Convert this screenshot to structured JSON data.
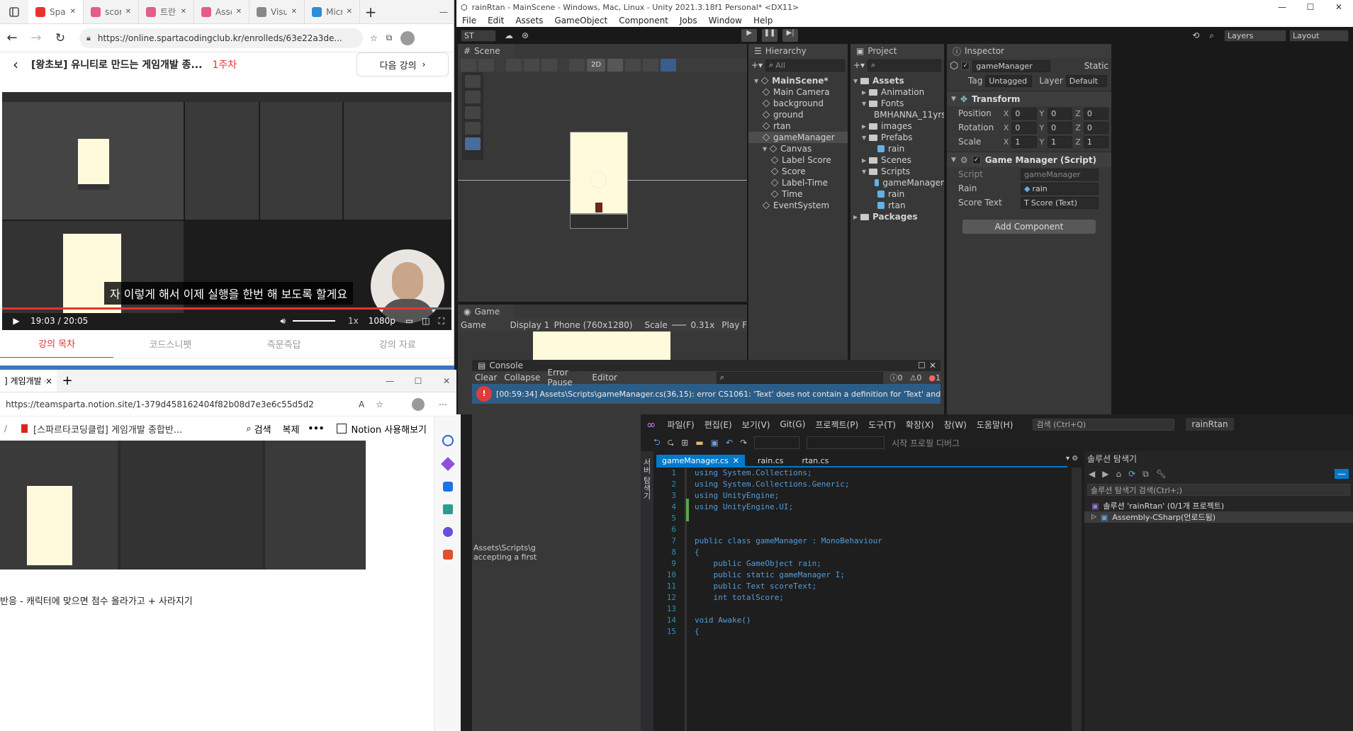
{
  "browser1": {
    "tabs": [
      {
        "label": "Spart",
        "color": "#e8342d"
      },
      {
        "label": "score",
        "color": "#e55b8a"
      },
      {
        "label": "트란",
        "color": "#e55b8a"
      },
      {
        "label": "Asset",
        "color": "#e55b8a"
      },
      {
        "label": "Visua",
        "color": "#888888"
      },
      {
        "label": "Micro",
        "color": "#2a8fd6"
      }
    ],
    "url": "https://online.spartacodingclub.kr/enrolleds/63e22a3de...",
    "course_title": "[왕초보] 유니티로 만드는 게임개발 종...",
    "week": "1주차",
    "next_lesson": "다음 강의",
    "subtitle": "자 이렇게 해서 이제 실행을 한번 해 보도록 할게요",
    "time_current": "19:03",
    "time_total": "20:05",
    "speed": "1x",
    "quality": "1080p",
    "progress": 0.95,
    "bottom_tabs": [
      "강의 목차",
      "코드스니펫",
      "즉문즉답",
      "강의 자료"
    ],
    "accent": "#e8342d"
  },
  "browser2": {
    "tab_label": "] 게임개발 종",
    "url": "https://teamsparta.notion.site/1-379d458162404f82b08d7e3e6c55d5d2",
    "breadcrumb": "[스파르타코딩클럽] 게임개발 종합반...",
    "search": "검색",
    "copy": "복제",
    "notion_btn": "Notion 사용해보기",
    "bottom_text": "반응 - 캐릭터에 맞으면 점수 올라가고 + 사라지기"
  },
  "unity": {
    "title": "rainRtan - MainScene - Windows, Mac, Linux - Unity 2021.3.18f1 Personal* <DX11>",
    "menu": [
      "File",
      "Edit",
      "Assets",
      "GameObject",
      "Component",
      "Jobs",
      "Window",
      "Help"
    ],
    "account": "ST",
    "layers": "Layers",
    "layout": "Layout",
    "scene_tab": "Scene",
    "game_tab": "Game",
    "btn_2d": "2D",
    "game_bar": {
      "display_mode": "Game",
      "display": "Display 1",
      "resolution": "Phone (760x1280)",
      "scale_label": "Scale",
      "scale": "0.31x",
      "play": "Play F"
    },
    "hierarchy": {
      "tab": "Hierarchy",
      "search": "All",
      "items": [
        {
          "label": "MainScene*",
          "depth": 0
        },
        {
          "label": "Main Camera",
          "depth": 1
        },
        {
          "label": "background",
          "depth": 1
        },
        {
          "label": "ground",
          "depth": 1
        },
        {
          "label": "rtan",
          "depth": 1
        },
        {
          "label": "gameManager",
          "depth": 1
        },
        {
          "label": "Canvas",
          "depth": 1
        },
        {
          "label": "Label Score",
          "depth": 2
        },
        {
          "label": "Score",
          "depth": 2
        },
        {
          "label": "Label-Time",
          "depth": 2
        },
        {
          "label": "Time",
          "depth": 2
        },
        {
          "label": "EventSystem",
          "depth": 1
        }
      ]
    },
    "project": {
      "tab": "Project",
      "items": [
        {
          "label": "Assets",
          "depth": 0
        },
        {
          "label": "Animation",
          "depth": 1
        },
        {
          "label": "Fonts",
          "depth": 1
        },
        {
          "label": "BMHANNA_11yrs",
          "depth": 2
        },
        {
          "label": "images",
          "depth": 1
        },
        {
          "label": "Prefabs",
          "depth": 1
        },
        {
          "label": "rain",
          "depth": 2
        },
        {
          "label": "Scenes",
          "depth": 1
        },
        {
          "label": "Scripts",
          "depth": 1
        },
        {
          "label": "gameManager",
          "depth": 2
        },
        {
          "label": "rain",
          "depth": 2
        },
        {
          "label": "rtan",
          "depth": 2
        },
        {
          "label": "Packages",
          "depth": 0
        }
      ]
    },
    "inspector": {
      "tab": "Inspector",
      "name": "gameManager",
      "static": "Static",
      "tag_label": "Tag",
      "tag": "Untagged",
      "layer_label": "Layer",
      "layer": "Default",
      "transform": "Transform",
      "position": [
        "0",
        "0",
        "0"
      ],
      "rotation": [
        "0",
        "0",
        "0"
      ],
      "scale": [
        "1",
        "1",
        "1"
      ],
      "script_component": "Game Manager (Script)",
      "script": "gameManager",
      "rain": "rain",
      "score_text": "Score (Text)",
      "add_component": "Add Component",
      "labels": {
        "position": "Position",
        "rotation": "Rotation",
        "scale": "Scale",
        "script": "Script",
        "rain": "Rain",
        "score_text": "Score Text"
      }
    },
    "console": {
      "tab": "Console",
      "clear": "Clear",
      "collapse": "Collapse",
      "error_pause": "Error Pause",
      "editor": "Editor",
      "counts": [
        "0",
        "0",
        "1"
      ],
      "error": "[00:59:34] Assets\\Scripts\\gameManager.cs(36,15): error CS1061: 'Text' does not contain a definition for 'Text' and no accessible extensi",
      "detail": "Assets\\Scripts\\g\naccepting a first"
    }
  },
  "vs": {
    "menu": [
      "파일(F)",
      "편집(E)",
      "보기(V)",
      "Git(G)",
      "프로젝트(P)",
      "도구(T)",
      "확장(X)",
      "창(W)",
      "도움말(H)"
    ],
    "search": "검색 (Ctrl+Q)",
    "project_name": "rainRtan",
    "toolbar_text": "시작 프로필 디버그",
    "tabs": [
      "gameManager.cs",
      "rain.cs",
      "rtan.cs"
    ],
    "code": [
      {
        "n": "1",
        "t": "using System.Collections;"
      },
      {
        "n": "2",
        "t": "using System.Collections.Generic;"
      },
      {
        "n": "3",
        "t": "using UnityEngine;"
      },
      {
        "n": "4",
        "t": "using UnityEngine.UI;"
      },
      {
        "n": "5",
        "t": ""
      },
      {
        "n": "6",
        "t": ""
      },
      {
        "n": "7",
        "t": "public class gameManager : MonoBehaviour"
      },
      {
        "n": "8",
        "t": "{"
      },
      {
        "n": "9",
        "t": "    public GameObject rain;"
      },
      {
        "n": "10",
        "t": "    public static gameManager I;"
      },
      {
        "n": "11",
        "t": "    public Text scoreText;"
      },
      {
        "n": "12",
        "t": "    int totalScore;"
      },
      {
        "n": "13",
        "t": ""
      },
      {
        "n": "14",
        "t": "void Awake()"
      },
      {
        "n": "15",
        "t": "{"
      }
    ],
    "solution": {
      "title": "솔루션 탐색기",
      "search": "솔루션 탐색기 검색(Ctrl+;)",
      "item1": "솔루션 'rainRtan' (0/1개 프로젝트)",
      "item2": "Assembly-CSharp(언로드됨)"
    },
    "side_label": "서버 탐색기"
  }
}
